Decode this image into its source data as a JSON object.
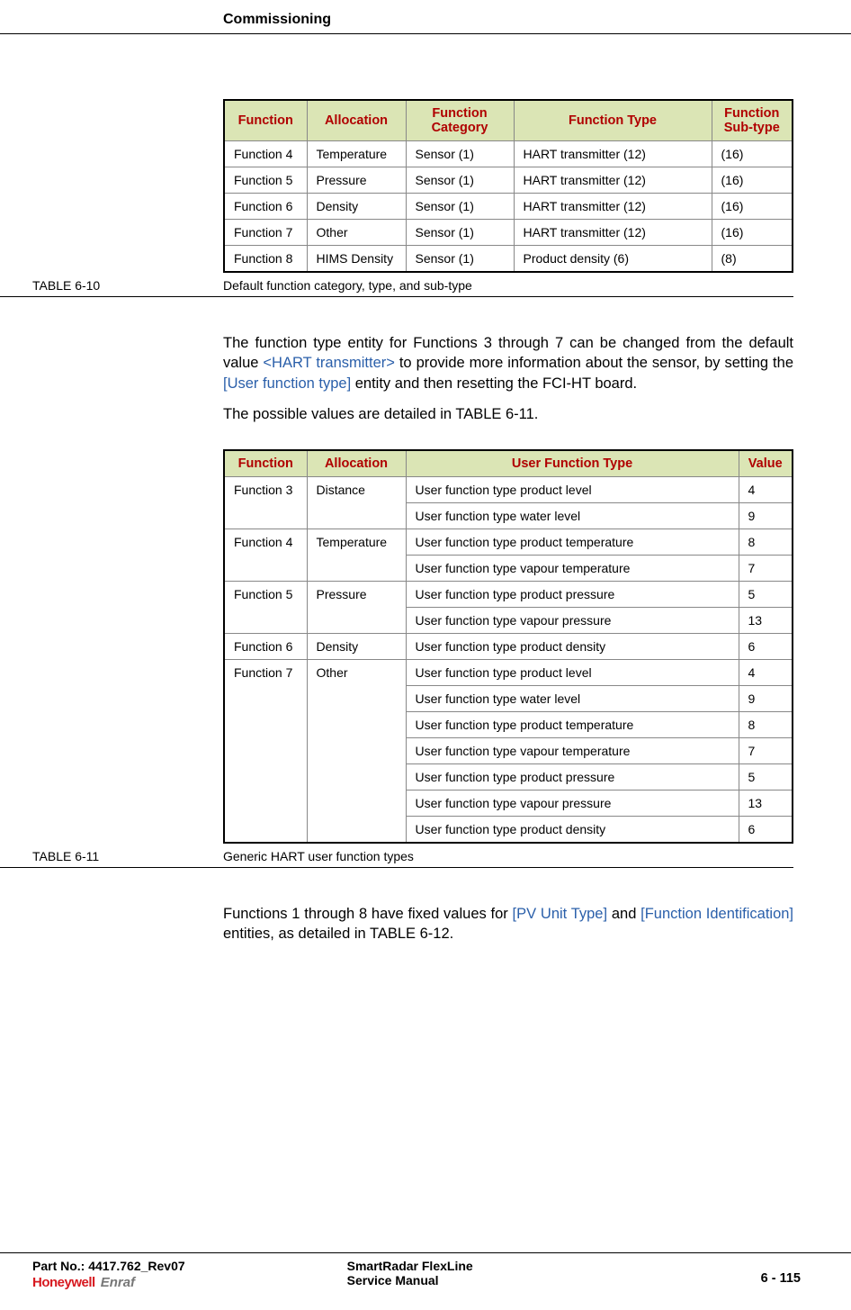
{
  "header": "Commissioning",
  "table1": {
    "number": "TABLE  6-10",
    "caption": "Default function category, type, and sub-type",
    "headers": [
      "Function",
      "Allocation",
      "Function Category",
      "Function Type",
      "Function Sub-type"
    ],
    "rows": [
      [
        "Function 4",
        "Temperature",
        "Sensor (1)",
        "HART transmitter (12)",
        "(16)"
      ],
      [
        "Function 5",
        "Pressure",
        "Sensor (1)",
        "HART transmitter (12)",
        "(16)"
      ],
      [
        "Function 6",
        "Density",
        "Sensor (1)",
        "HART transmitter (12)",
        "(16)"
      ],
      [
        "Function 7",
        "Other",
        "Sensor (1)",
        "HART transmitter (12)",
        "(16)"
      ],
      [
        "Function 8",
        "HIMS Density",
        "Sensor (1)",
        "Product density (6)",
        "(8)"
      ]
    ]
  },
  "para1_a": "The function type entity for Functions 3 through 7 can be changed from the default value ",
  "para1_entity1": "<HART transmitter>",
  "para1_b": " to provide more information about the sensor, by setting the ",
  "para1_entity2": "[User function type]",
  "para1_c": " entity and then resetting the FCI-HT board.",
  "para2": "The possible values are detailed in TABLE 6-11.",
  "table2": {
    "number": "TABLE  6-11",
    "caption": "Generic HART user function types",
    "headers": [
      "Function",
      "Allocation",
      "User Function Type",
      "Value"
    ],
    "groups": [
      {
        "fn": "Function 3",
        "alloc": "Distance",
        "rows": [
          [
            "User function type product level",
            "4"
          ],
          [
            "User function type water level",
            "9"
          ]
        ]
      },
      {
        "fn": "Function 4",
        "alloc": "Temperature",
        "rows": [
          [
            "User function type product temperature",
            "8"
          ],
          [
            "User function type vapour temperature",
            "7"
          ]
        ]
      },
      {
        "fn": "Function 5",
        "alloc": "Pressure",
        "rows": [
          [
            "User function type product pressure",
            "5"
          ],
          [
            "User function type vapour pressure",
            "13"
          ]
        ]
      },
      {
        "fn": "Function 6",
        "alloc": "Density",
        "rows": [
          [
            "User function type product density",
            "6"
          ]
        ]
      },
      {
        "fn": "Function 7",
        "alloc": "Other",
        "rows": [
          [
            "User function type product level",
            "4"
          ],
          [
            "User function type water level",
            "9"
          ],
          [
            "User function type product temperature",
            "8"
          ],
          [
            "User function type vapour temperature",
            "7"
          ],
          [
            "User function type product pressure",
            "5"
          ],
          [
            "User function type vapour pressure",
            "13"
          ],
          [
            "User function type product density",
            "6"
          ]
        ]
      }
    ]
  },
  "para3_a": "Functions 1 through 8 have fixed values for ",
  "para3_entity1": "[PV Unit Type]",
  "para3_b": " and ",
  "para3_entity2": "[Function Identification]",
  "para3_c": " entities, as detailed in TABLE 6-12.",
  "footer": {
    "part": "Part No.: 4417.762_Rev07",
    "logo1": "Honeywell",
    "logo2": "Enraf",
    "title1": "SmartRadar FlexLine",
    "title2": "Service Manual",
    "page": "6 - 115"
  }
}
